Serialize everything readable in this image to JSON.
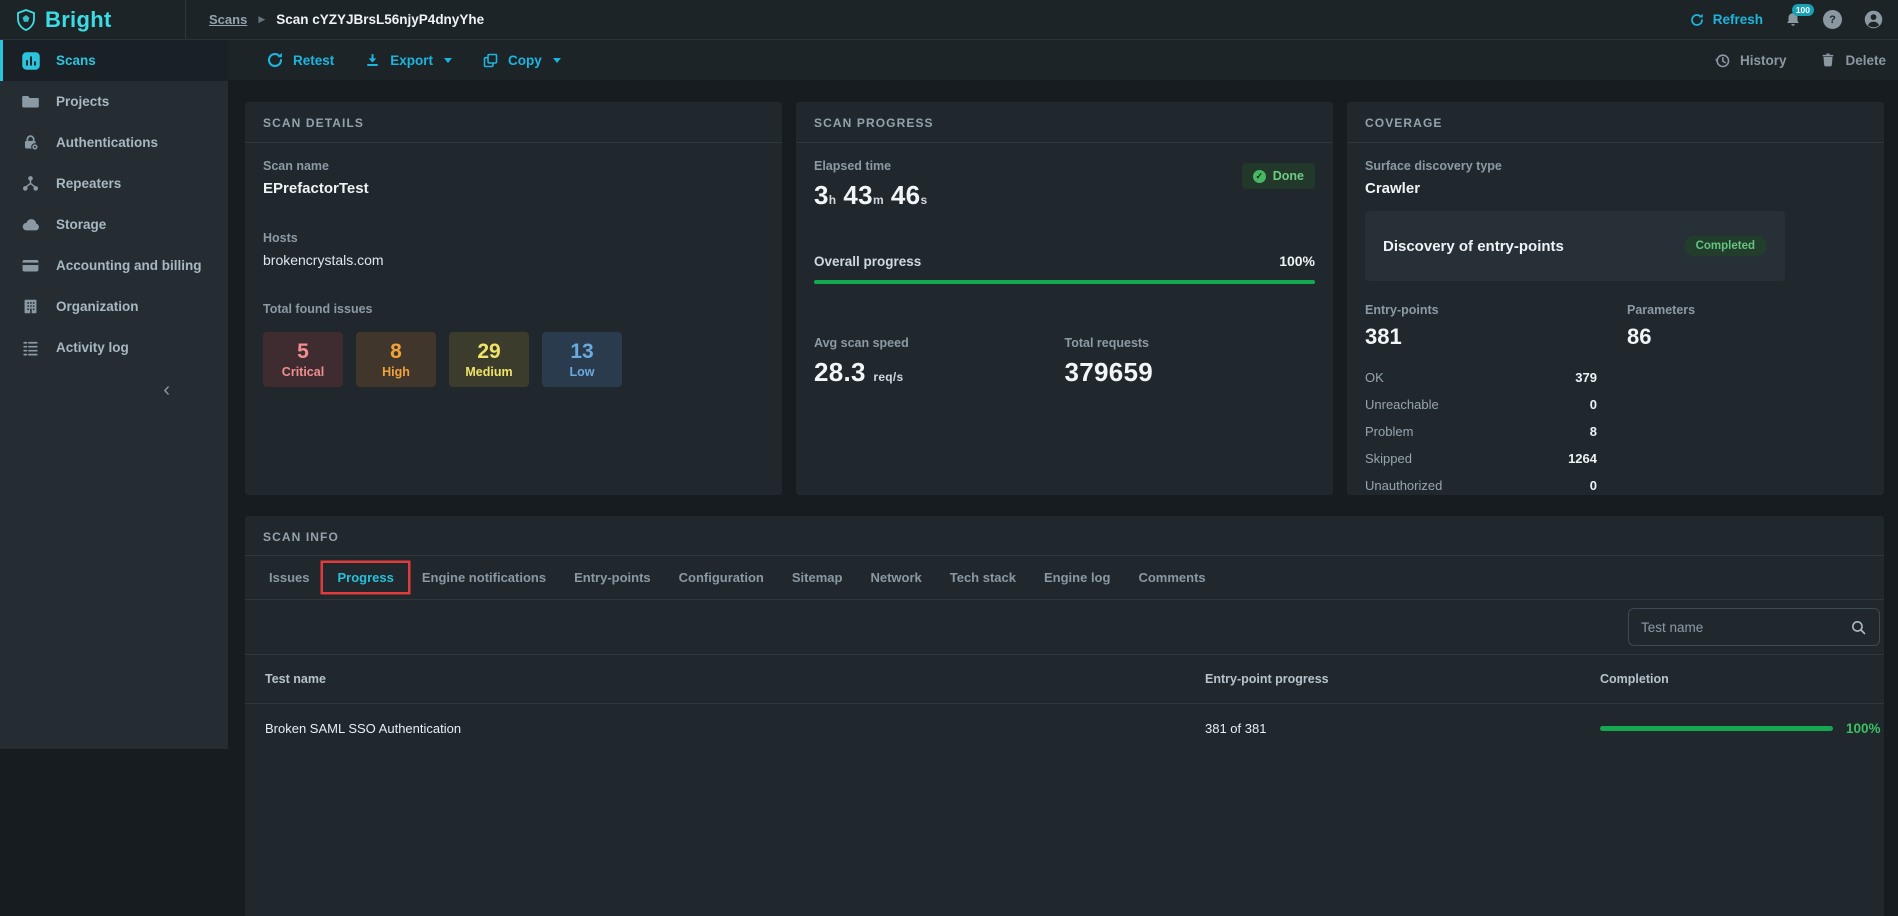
{
  "topbar": {
    "logo_text": "Bright",
    "breadcrumb": {
      "root": "Scans",
      "current": "Scan cYZYJBrsL56njyP4dnyYhe"
    },
    "refresh_label": "Refresh",
    "notification_count": "100"
  },
  "icons": {
    "breadcrumb_separator": "▶",
    "question_mark": "?",
    "check_mark": "✓",
    "collapse_chevron": "‹"
  },
  "sidebar": {
    "items": [
      {
        "label": "Scans",
        "icon": "bar-chart",
        "active": true
      },
      {
        "label": "Projects",
        "icon": "folder",
        "active": false
      },
      {
        "label": "Authentications",
        "icon": "lock",
        "active": false
      },
      {
        "label": "Repeaters",
        "icon": "network-nodes",
        "active": false
      },
      {
        "label": "Storage",
        "icon": "cloud",
        "active": false
      },
      {
        "label": "Accounting and billing",
        "icon": "credit-card",
        "active": false
      },
      {
        "label": "Organization",
        "icon": "building",
        "active": false
      },
      {
        "label": "Activity log",
        "icon": "list-lines",
        "active": false
      }
    ]
  },
  "toolbar": {
    "retest_label": "Retest",
    "export_label": "Export",
    "copy_label": "Copy",
    "history_label": "History",
    "delete_label": "Delete"
  },
  "scan_details": {
    "title": "SCAN DETAILS",
    "scan_name_label": "Scan name",
    "scan_name": "EPrefactorTest",
    "hosts_label": "Hosts",
    "hosts": "brokencrystals.com",
    "issues_label": "Total found issues",
    "issues": [
      {
        "count": "5",
        "label": "Critical",
        "fg": "#ef8f8f",
        "bg": "#3f2c31"
      },
      {
        "count": "8",
        "label": "High",
        "fg": "#f0a33c",
        "bg": "#40362b"
      },
      {
        "count": "29",
        "label": "Medium",
        "fg": "#efe36a",
        "bg": "#3c3c2d"
      },
      {
        "count": "13",
        "label": "Low",
        "fg": "#6aaade",
        "bg": "#2a3b4d"
      }
    ]
  },
  "scan_progress": {
    "title": "SCAN PROGRESS",
    "elapsed_label": "Elapsed time",
    "elapsed": [
      {
        "value": "3",
        "unit": "h"
      },
      {
        "value": "43",
        "unit": "m"
      },
      {
        "value": "46",
        "unit": "s"
      }
    ],
    "status": "Done",
    "overall_label": "Overall progress",
    "overall_value": "100%",
    "speed_label": "Avg scan speed",
    "speed_value": "28.3",
    "speed_unit": "req/s",
    "requests_label": "Total requests",
    "requests_value": "379659"
  },
  "coverage": {
    "title": "COVERAGE",
    "discovery_label": "Surface discovery type",
    "discovery_value": "Crawler",
    "entrypoint_discovery_label": "Discovery of entry-points",
    "entrypoint_discovery_status": "Completed",
    "entry_points_label": "Entry-points",
    "entry_points_value": "381",
    "parameters_label": "Parameters",
    "parameters_value": "86",
    "stats": [
      {
        "label": "OK",
        "value": "379"
      },
      {
        "label": "Unreachable",
        "value": "0"
      },
      {
        "label": "Problem",
        "value": "8"
      },
      {
        "label": "Skipped",
        "value": "1264"
      },
      {
        "label": "Unauthorized",
        "value": "0"
      }
    ]
  },
  "scan_info": {
    "title": "SCAN INFO",
    "tabs": [
      {
        "label": "Issues"
      },
      {
        "label": "Progress",
        "active": true,
        "annotated": true
      },
      {
        "label": "Engine notifications"
      },
      {
        "label": "Entry-points"
      },
      {
        "label": "Configuration"
      },
      {
        "label": "Sitemap"
      },
      {
        "label": "Network"
      },
      {
        "label": "Tech stack"
      },
      {
        "label": "Engine log"
      },
      {
        "label": "Comments"
      }
    ],
    "search_placeholder": "Test name",
    "table": {
      "headers": [
        "Test name",
        "Entry-point progress",
        "Completion"
      ],
      "rows": [
        {
          "test_name": "Broken SAML SSO Authentication",
          "entry_point_progress": "381 of 381",
          "completion": "100%",
          "completion_pct": 100
        }
      ]
    }
  },
  "colors": {
    "accent_cyan": "#1cb5dd",
    "progress_green": "#14a850",
    "completion_text_green": "#3cc063",
    "annotation_red": "#e03a3a",
    "done_badge_bg": "#22382a",
    "done_badge_fg": "#6ecb83"
  }
}
